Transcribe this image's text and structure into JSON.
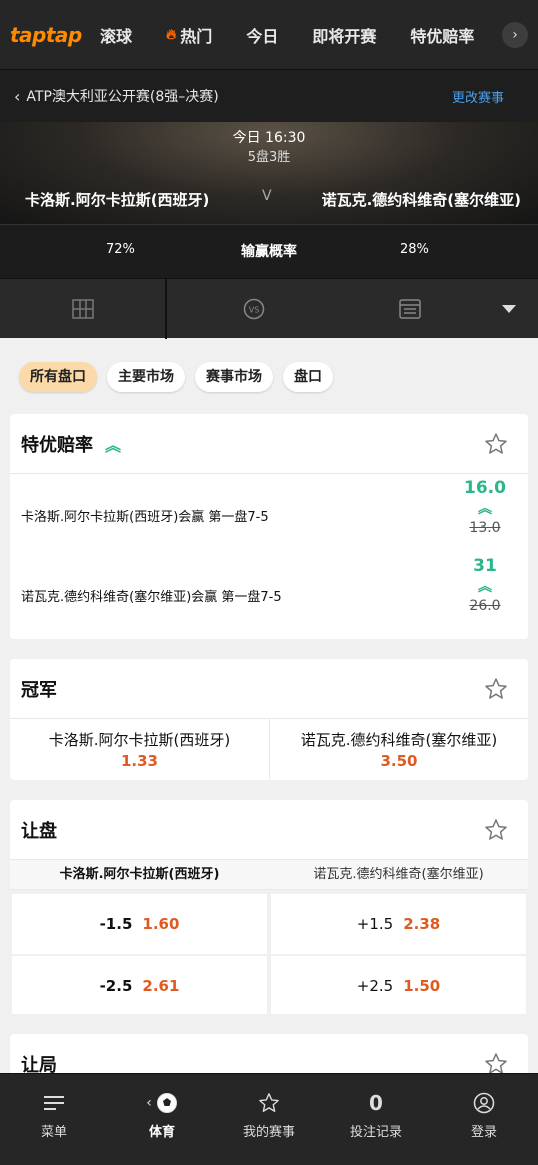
{
  "topnav": {
    "logo": "taptap",
    "items": [
      "滚球",
      "热门",
      "今日",
      "即将开赛",
      "特优赔率"
    ]
  },
  "event": {
    "title": "ATP澳大利亚公开赛(8强–决赛)",
    "change_label": "更改赛事",
    "time": "今日 16:30",
    "format": "5盘3胜",
    "home": "卡洛斯.阿尔卡拉斯(西班牙)",
    "vs": "V",
    "away": "诺瓦克.德约科维奇(塞尔维亚)",
    "home_prob": "72%",
    "prob_label": "输赢概率",
    "away_prob": "28%"
  },
  "chips": [
    "所有盘口",
    "主要市场",
    "赛事市场",
    "盘口"
  ],
  "special": {
    "title": "特优赔率",
    "rows": [
      {
        "label": "卡洛斯.阿尔卡拉斯(西班牙)会赢 第一盘7-5",
        "new_odds": "16.0",
        "old_odds": "13.0"
      },
      {
        "label": "诺瓦克.德约科维奇(塞尔维亚)会赢 第一盘7-5",
        "new_odds": "31",
        "old_odds": "26.0"
      }
    ]
  },
  "winner": {
    "title": "冠军",
    "home_name": "卡洛斯.阿尔卡拉斯(西班牙)",
    "home_odds": "1.33",
    "away_name": "诺瓦克.德约科维奇(塞尔维亚)",
    "away_odds": "3.50"
  },
  "handicap": {
    "title": "让盘",
    "home_header": "卡洛斯.阿尔卡拉斯(西班牙)",
    "away_header": "诺瓦克.德约科维奇(塞尔维亚)",
    "home": [
      {
        "line": "-1.5",
        "price": "1.60"
      },
      {
        "line": "-2.5",
        "price": "2.61"
      }
    ],
    "away": [
      {
        "line": "+1.5",
        "price": "2.38"
      },
      {
        "line": "+2.5",
        "price": "1.50"
      }
    ]
  },
  "games_handicap": {
    "title": "让局"
  },
  "bottombar": {
    "menu": "菜单",
    "sports": "体育",
    "my_events": "我的赛事",
    "bet_count": "0",
    "bet_records": "投注记录",
    "login": "登录"
  },
  "colors": {
    "accent": "#ff8a00",
    "boost": "#2bb58a",
    "odds": "#e15a1f",
    "link": "#4a9fe8"
  }
}
